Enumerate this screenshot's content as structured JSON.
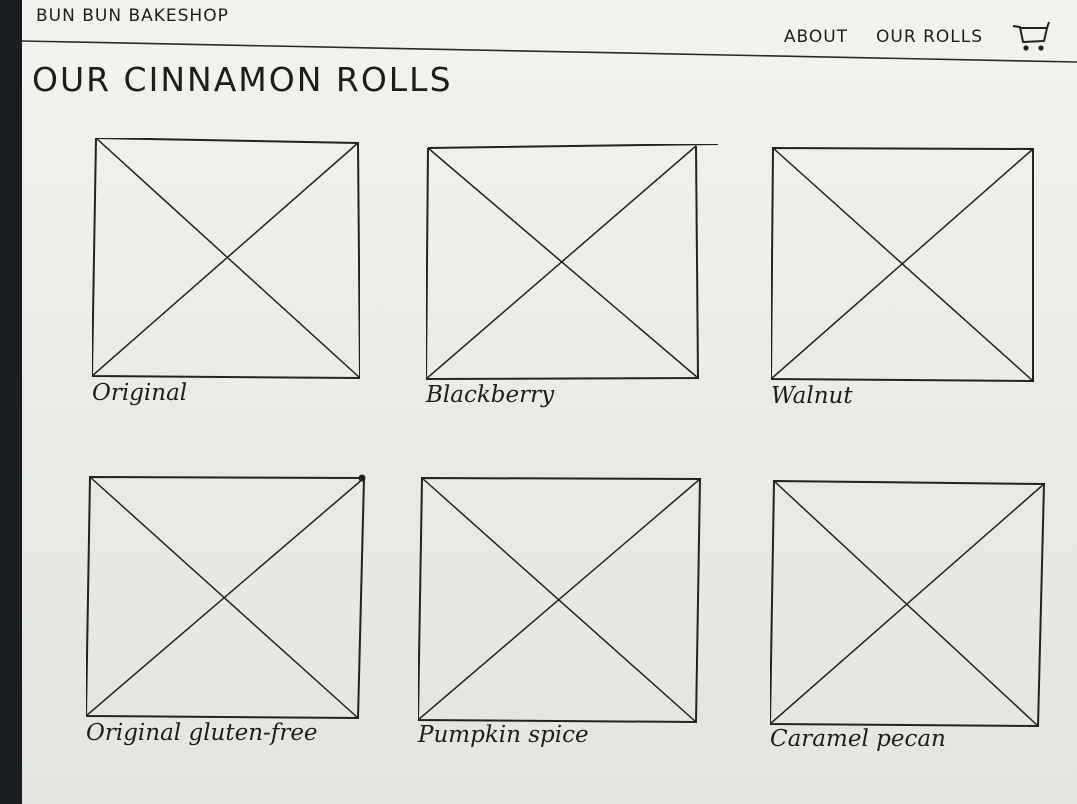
{
  "header": {
    "brand": "BUN BUN BAKESHOP",
    "nav": [
      {
        "label": "ABOUT"
      },
      {
        "label": "OUR ROLLS"
      }
    ],
    "cart_icon": "shopping-cart-icon"
  },
  "main": {
    "title": "OUR CINNAMON ROLLS",
    "products": [
      {
        "name": "Original",
        "image_icon": "image-placeholder-icon"
      },
      {
        "name": "Blackberry",
        "image_icon": "image-placeholder-icon"
      },
      {
        "name": "Walnut",
        "image_icon": "image-placeholder-icon"
      },
      {
        "name": "Original gluten-free",
        "image_icon": "image-placeholder-icon"
      },
      {
        "name": "Pumpkin spice",
        "image_icon": "image-placeholder-icon"
      },
      {
        "name": "Caramel pecan",
        "image_icon": "image-placeholder-icon"
      }
    ]
  }
}
